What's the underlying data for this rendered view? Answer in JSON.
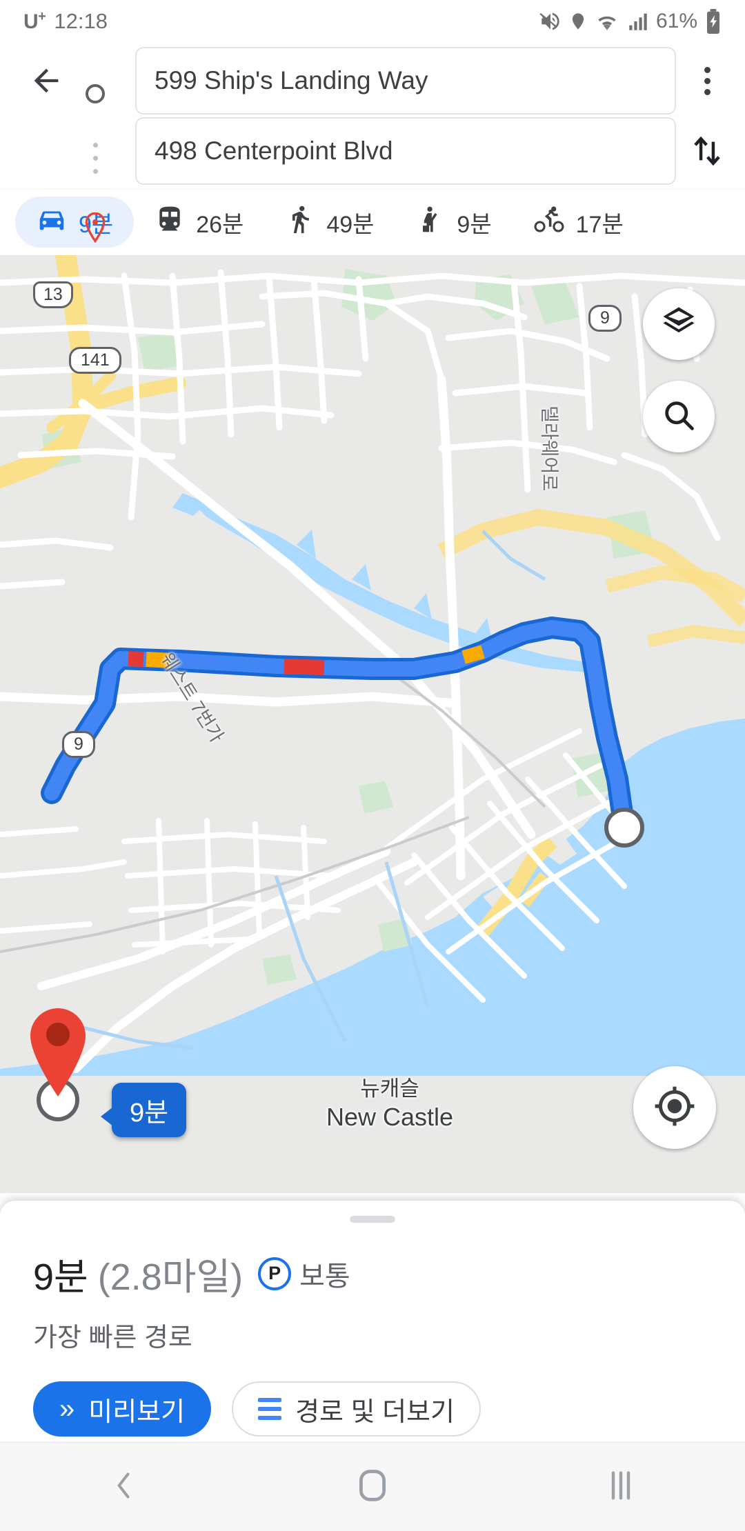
{
  "status_bar": {
    "carrier": "U",
    "carrier_sup": "+",
    "time": "12:18",
    "battery": "61%",
    "icons": [
      "mute-icon",
      "location-icon",
      "wifi-icon",
      "signal-icon",
      "battery-charging-icon"
    ]
  },
  "header": {
    "back_icon": "back-arrow-icon",
    "origin": {
      "value": "599 Ship's Landing Way",
      "marker": "origin-circle-icon"
    },
    "destination": {
      "value": "498 Centerpoint Blvd",
      "marker": "destination-pin-icon"
    },
    "overflow_icon": "more-vert-icon",
    "swap_icon": "swap-vertical-icon"
  },
  "modes": [
    {
      "id": "driving",
      "icon": "car-icon",
      "duration": "9분",
      "active": true
    },
    {
      "id": "transit",
      "icon": "train-icon",
      "duration": "26분",
      "active": false
    },
    {
      "id": "walking",
      "icon": "walk-icon",
      "duration": "49분",
      "active": false
    },
    {
      "id": "rideshare",
      "icon": "rideshare-icon",
      "duration": "9분",
      "active": false
    },
    {
      "id": "cycling",
      "icon": "bike-icon",
      "duration": "17분",
      "active": false
    }
  ],
  "map": {
    "route_eta_badge": "9분",
    "place_label_ko": "뉴캐슬",
    "place_label_en": "New Castle",
    "road_label_1": "델라웨어로",
    "road_label_2": "웨스트 7번가",
    "shields": [
      {
        "name": "us-13",
        "label": "13",
        "type": "us"
      },
      {
        "name": "route-141",
        "label": "141",
        "type": "oval"
      },
      {
        "name": "route-9-north",
        "label": "9",
        "type": "oval"
      },
      {
        "name": "route-9-south",
        "label": "9",
        "type": "oval"
      }
    ],
    "controls": [
      {
        "name": "layers-button",
        "icon": "layers-icon"
      },
      {
        "name": "search-button",
        "icon": "search-icon"
      },
      {
        "name": "my-location-button",
        "icon": "my-location-icon"
      }
    ],
    "colors": {
      "route": "#4285f4",
      "route_outline": "#1967d2",
      "traffic_slow": "#f9ab00",
      "traffic_heavy": "#e53935",
      "water": "#aadaff",
      "land": "#e9e9e7",
      "park": "#cfe8cf",
      "highway": "#fbe08a",
      "road": "#ffffff"
    }
  },
  "sheet": {
    "grabber": "drag-handle",
    "duration": "9분",
    "distance": "(2.8마일)",
    "parking_badge": "P",
    "parking_label": "보통",
    "subtitle": "가장 빠른 경로",
    "preview_button": "미리보기",
    "steps_button": "경로 및 더보기"
  },
  "navbar": {
    "back": "back-nav-icon",
    "home": "home-nav-icon",
    "recents": "recents-nav-icon"
  }
}
